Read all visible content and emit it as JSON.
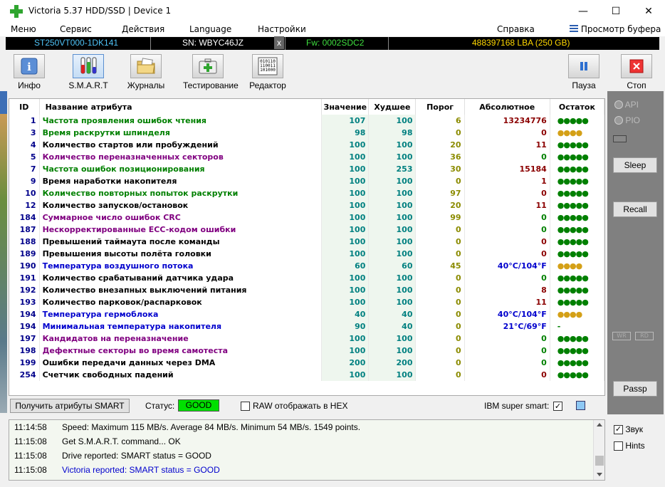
{
  "window": {
    "title": "Victoria 5.37 HDD/SSD | Device 1",
    "minimize_glyph": "—",
    "maximize_glyph": "☐",
    "close_glyph": "✕"
  },
  "menu": {
    "items": [
      "Меню",
      "Сервис",
      "Действия",
      "Language",
      "Настройки"
    ],
    "help": "Справка",
    "buffer": "Просмотр буфера"
  },
  "drive": {
    "model": "ST250VT000-1DK141",
    "serial": "SN: WBYC46JZ",
    "close_mark": "x",
    "firmware": "Fw: 0002SDC2",
    "capacity": "488397168 LBA (250 GB)"
  },
  "toolbar": {
    "info": "Инфо",
    "smart": "S.M.A.R.T",
    "logs": "Журналы",
    "testing": "Тестирование",
    "editor": "Редактор",
    "pause": "Пауза",
    "stop": "Стоп"
  },
  "table": {
    "headers": [
      "ID",
      "Название атрибута",
      "Значение",
      "Худшее",
      "Порог",
      "Абсолютное",
      "Остаток"
    ],
    "rows": [
      {
        "id": "1",
        "name": "Частота проявления ошибок чтения",
        "value": "107",
        "worst": "100",
        "threshold": "6",
        "absolute": "13234776",
        "remain": "●●●●●",
        "name_color": "#008000",
        "abs_color": "#8b0000",
        "rem_color": "#008000"
      },
      {
        "id": "3",
        "name": "Время раскрутки шпинделя",
        "value": "98",
        "worst": "98",
        "threshold": "0",
        "absolute": "0",
        "remain": "●●●●",
        "name_color": "#008000",
        "abs_color": "#8b0000",
        "rem_color": "#d4a017"
      },
      {
        "id": "4",
        "name": "Количество стартов или пробуждений",
        "value": "100",
        "worst": "100",
        "threshold": "20",
        "absolute": "11",
        "remain": "●●●●●",
        "name_color": "#000000",
        "abs_color": "#8b0000",
        "rem_color": "#008000"
      },
      {
        "id": "5",
        "name": "Количество переназначенных секторов",
        "value": "100",
        "worst": "100",
        "threshold": "36",
        "absolute": "0",
        "remain": "●●●●●",
        "name_color": "#800080",
        "abs_color": "#008000",
        "rem_color": "#008000"
      },
      {
        "id": "7",
        "name": "Частота ошибок позиционирования",
        "value": "100",
        "worst": "253",
        "threshold": "30",
        "absolute": "15184",
        "remain": "●●●●●",
        "name_color": "#008000",
        "abs_color": "#8b0000",
        "rem_color": "#008000"
      },
      {
        "id": "9",
        "name": "Время наработки накопителя",
        "value": "100",
        "worst": "100",
        "threshold": "0",
        "absolute": "1",
        "remain": "●●●●●",
        "name_color": "#000000",
        "abs_color": "#8b0000",
        "rem_color": "#008000"
      },
      {
        "id": "10",
        "name": "Количество повторных попыток раскрутки",
        "value": "100",
        "worst": "100",
        "threshold": "97",
        "absolute": "0",
        "remain": "●●●●●",
        "name_color": "#008000",
        "abs_color": "#8b0000",
        "rem_color": "#008000"
      },
      {
        "id": "12",
        "name": "Количество запусков/остановок",
        "value": "100",
        "worst": "100",
        "threshold": "20",
        "absolute": "11",
        "remain": "●●●●●",
        "name_color": "#000000",
        "abs_color": "#8b0000",
        "rem_color": "#008000"
      },
      {
        "id": "184",
        "name": "Суммарное число ошибок CRC",
        "value": "100",
        "worst": "100",
        "threshold": "99",
        "absolute": "0",
        "remain": "●●●●●",
        "name_color": "#800080",
        "abs_color": "#008000",
        "rem_color": "#008000"
      },
      {
        "id": "187",
        "name": "Нескорректированные ECC-кодом ошибки",
        "value": "100",
        "worst": "100",
        "threshold": "0",
        "absolute": "0",
        "remain": "●●●●●",
        "name_color": "#800080",
        "abs_color": "#008000",
        "rem_color": "#008000"
      },
      {
        "id": "188",
        "name": "Превышений таймаута после команды",
        "value": "100",
        "worst": "100",
        "threshold": "0",
        "absolute": "0",
        "remain": "●●●●●",
        "name_color": "#000000",
        "abs_color": "#8b0000",
        "rem_color": "#008000"
      },
      {
        "id": "189",
        "name": "Превышения высоты полёта головки",
        "value": "100",
        "worst": "100",
        "threshold": "0",
        "absolute": "0",
        "remain": "●●●●●",
        "name_color": "#000000",
        "abs_color": "#8b0000",
        "rem_color": "#008000"
      },
      {
        "id": "190",
        "name": "Температура воздушного потока",
        "value": "60",
        "worst": "60",
        "threshold": "45",
        "absolute": "40°C/104°F",
        "remain": "●●●●",
        "name_color": "#0000cd",
        "abs_color": "#0000cd",
        "rem_color": "#d4a017"
      },
      {
        "id": "191",
        "name": "Количество срабатываний датчика удара",
        "value": "100",
        "worst": "100",
        "threshold": "0",
        "absolute": "0",
        "remain": "●●●●●",
        "name_color": "#000000",
        "abs_color": "#008000",
        "rem_color": "#008000"
      },
      {
        "id": "192",
        "name": "Количество внезапных выключений питания",
        "value": "100",
        "worst": "100",
        "threshold": "0",
        "absolute": "8",
        "remain": "●●●●●",
        "name_color": "#000000",
        "abs_color": "#8b0000",
        "rem_color": "#008000"
      },
      {
        "id": "193",
        "name": "Количество парковок/распарковок",
        "value": "100",
        "worst": "100",
        "threshold": "0",
        "absolute": "11",
        "remain": "●●●●●",
        "name_color": "#000000",
        "abs_color": "#8b0000",
        "rem_color": "#008000"
      },
      {
        "id": "194",
        "name": "Температура гермоблока",
        "value": "40",
        "worst": "40",
        "threshold": "0",
        "absolute": "40°C/104°F",
        "remain": "●●●●",
        "name_color": "#0000cd",
        "abs_color": "#0000cd",
        "rem_color": "#d4a017"
      },
      {
        "id": "194",
        "name": "Минимальная температура накопителя",
        "value": "90",
        "worst": "40",
        "threshold": "0",
        "absolute": "21°C/69°F",
        "remain": "-",
        "name_color": "#0000cd",
        "abs_color": "#0000cd",
        "rem_color": "#008000"
      },
      {
        "id": "197",
        "name": "Кандидатов на переназначение",
        "value": "100",
        "worst": "100",
        "threshold": "0",
        "absolute": "0",
        "remain": "●●●●●",
        "name_color": "#800080",
        "abs_color": "#008000",
        "rem_color": "#008000"
      },
      {
        "id": "198",
        "name": "Дефектные секторы во время самотеста",
        "value": "100",
        "worst": "100",
        "threshold": "0",
        "absolute": "0",
        "remain": "●●●●●",
        "name_color": "#800080",
        "abs_color": "#008000",
        "rem_color": "#008000"
      },
      {
        "id": "199",
        "name": "Ошибки передачи данных через DMA",
        "value": "200",
        "worst": "200",
        "threshold": "0",
        "absolute": "0",
        "remain": "●●●●●",
        "name_color": "#000000",
        "abs_color": "#008000",
        "rem_color": "#008000"
      },
      {
        "id": "254",
        "name": "Счетчик свободных падений",
        "value": "100",
        "worst": "100",
        "threshold": "0",
        "absolute": "0",
        "remain": "●●●●●",
        "name_color": "#000000",
        "abs_color": "#8b0000",
        "rem_color": "#008000"
      }
    ]
  },
  "bottom": {
    "get_smart": "Получить атрибуты SMART",
    "status_label": "Статус:",
    "status_value": "GOOD",
    "raw_hex": "RAW отображать в HEX",
    "ibm": "IBM super smart:",
    "ibm_check": "✓"
  },
  "right_panel": {
    "api": "API",
    "pio": "PIO",
    "sleep": "Sleep",
    "recall": "Recall",
    "wr": "WR",
    "rd": "RD",
    "passp": "Passp"
  },
  "log": [
    {
      "time": "11:14:58",
      "msg": "Speed: Maximum 115 MB/s. Average 84 MB/s. Minimum 54 MB/s. 1549 points.",
      "color": "#000000"
    },
    {
      "time": "11:15:08",
      "msg": "Get S.M.A.R.T. command... OK",
      "color": "#000000"
    },
    {
      "time": "11:15:08",
      "msg": "Drive reported: SMART status = GOOD",
      "color": "#000000"
    },
    {
      "time": "11:15:08",
      "msg": "Victoria reported: SMART status = GOOD",
      "color": "#0000cd"
    }
  ],
  "options": {
    "sound": "Звук",
    "sound_check": "✓",
    "hints": "Hints"
  }
}
